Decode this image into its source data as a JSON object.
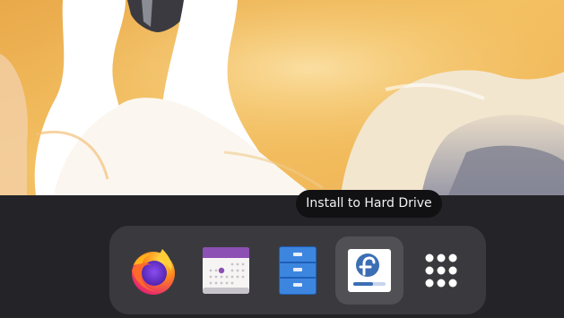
{
  "tooltip": {
    "text": "Install to Hard Drive"
  },
  "dock": {
    "items": [
      {
        "name": "Firefox",
        "icon": "firefox-icon"
      },
      {
        "name": "Calendar",
        "icon": "calendar-icon"
      },
      {
        "name": "Files",
        "icon": "file-cabinet-icon"
      },
      {
        "name": "Install to Hard Drive",
        "icon": "fedora-installer-icon",
        "active": true
      },
      {
        "name": "Show Applications",
        "icon": "app-grid-icon"
      }
    ]
  },
  "colors": {
    "shell_background": "#242428",
    "dock_background": "#3a3a3e",
    "dock_active": "#505055",
    "tooltip_background": "#111113",
    "wallpaper_sky": "#f0b84d",
    "fedora_blue": "#3c6eb4"
  }
}
